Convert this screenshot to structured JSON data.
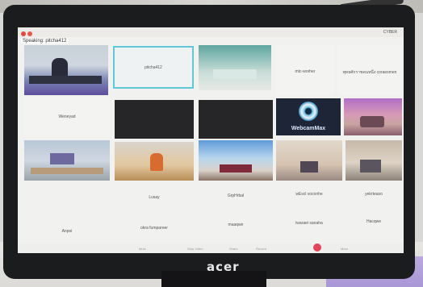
{
  "monitor": {
    "brand": "acer"
  },
  "window": {
    "title": "CYBER"
  },
  "meeting": {
    "speaking": "Speaking: pitcha412",
    "tiles": [
      {
        "label": "pitcha412"
      },
      {
        "label": "mtc-worher"
      },
      {
        "label": "พุทธศักราชคนหนึ่ง coraesmen"
      },
      {
        "label": "Weneyad"
      },
      {
        "label": "WebcamMax"
      },
      {
        "label": "Lusay"
      },
      {
        "label": "GrpHrbal"
      },
      {
        "label": "wEscl voconhe"
      },
      {
        "label": "yekrteaso"
      },
      {
        "label": "Anpoi"
      },
      {
        "label": "okra fumpareer"
      },
      {
        "label": "maaqwe"
      },
      {
        "label": "iwaraei sanaha"
      },
      {
        "label": "Hacqwe"
      }
    ]
  },
  "toolbar": {
    "mute": "Mute",
    "video": "Stop Video",
    "share": "Share",
    "record": "Record",
    "more": "More"
  }
}
